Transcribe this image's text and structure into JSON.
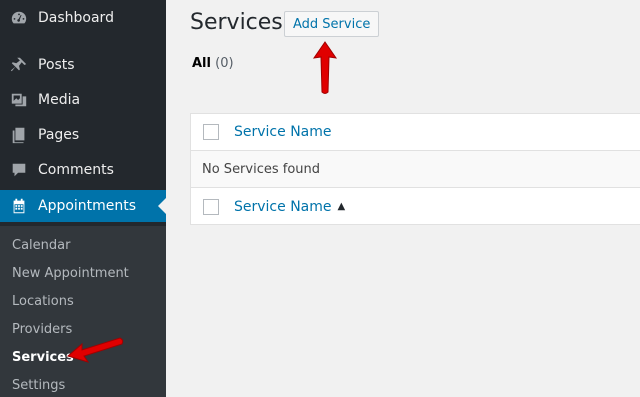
{
  "sidebar": {
    "items": [
      {
        "label": "Dashboard",
        "icon": "dashboard-icon"
      },
      {
        "label": "Posts",
        "icon": "pin-icon"
      },
      {
        "label": "Media",
        "icon": "media-icon"
      },
      {
        "label": "Pages",
        "icon": "pages-icon"
      },
      {
        "label": "Comments",
        "icon": "comment-icon"
      },
      {
        "label": "Appointments",
        "icon": "calendar-icon"
      }
    ],
    "submenu": [
      {
        "label": "Calendar"
      },
      {
        "label": "New Appointment"
      },
      {
        "label": "Locations"
      },
      {
        "label": "Providers"
      },
      {
        "label": "Services"
      },
      {
        "label": "Settings"
      }
    ],
    "active_color": "#0073aa",
    "background": "#23282d"
  },
  "main": {
    "title": "Services",
    "add_button": "Add Service",
    "filter": {
      "all_label": "All",
      "count": "(0)"
    },
    "table": {
      "header_column": "Service Name",
      "empty_message": "No Services found",
      "footer_column": "Service Name",
      "sort_indicator": "▲"
    }
  },
  "annotations": {
    "arrow_color": "#e00000"
  }
}
